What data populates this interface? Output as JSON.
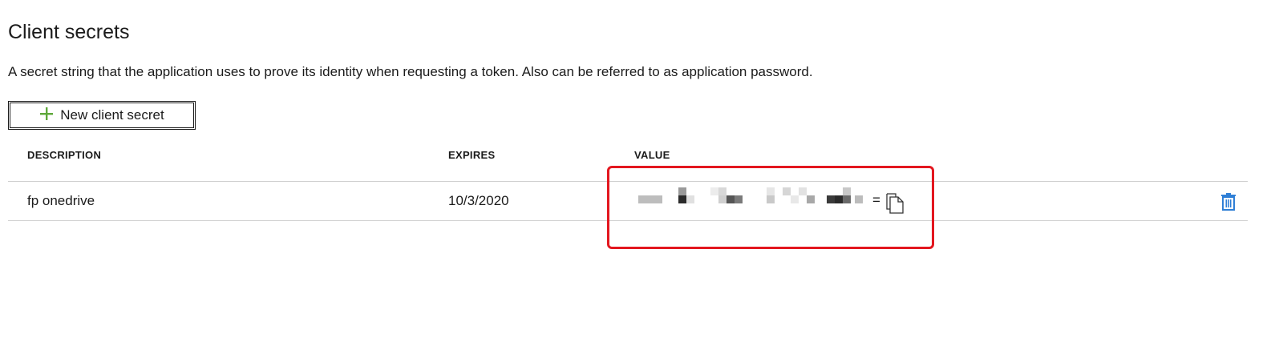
{
  "section": {
    "title": "Client secrets",
    "description": "A secret string that the application uses to prove its identity when requesting a token. Also can be referred to as application password."
  },
  "toolbar": {
    "new_secret_label": "New client secret",
    "plus_icon": "plus-icon",
    "plus_color": "#5ea83a"
  },
  "table": {
    "columns": [
      "DESCRIPTION",
      "EXPIRES",
      "VALUE"
    ],
    "rows": [
      {
        "description": "fp onedrive",
        "expires": "10/3/2020",
        "value_suffix": "=",
        "value_obscured": true,
        "copy_icon": "copy-icon",
        "delete_icon": "trash-icon"
      }
    ]
  },
  "colors": {
    "highlight": "#e3171f",
    "delete_icon": "#2f7fd6",
    "text": "#1b1b1b",
    "divider": "#d0d0d0"
  }
}
